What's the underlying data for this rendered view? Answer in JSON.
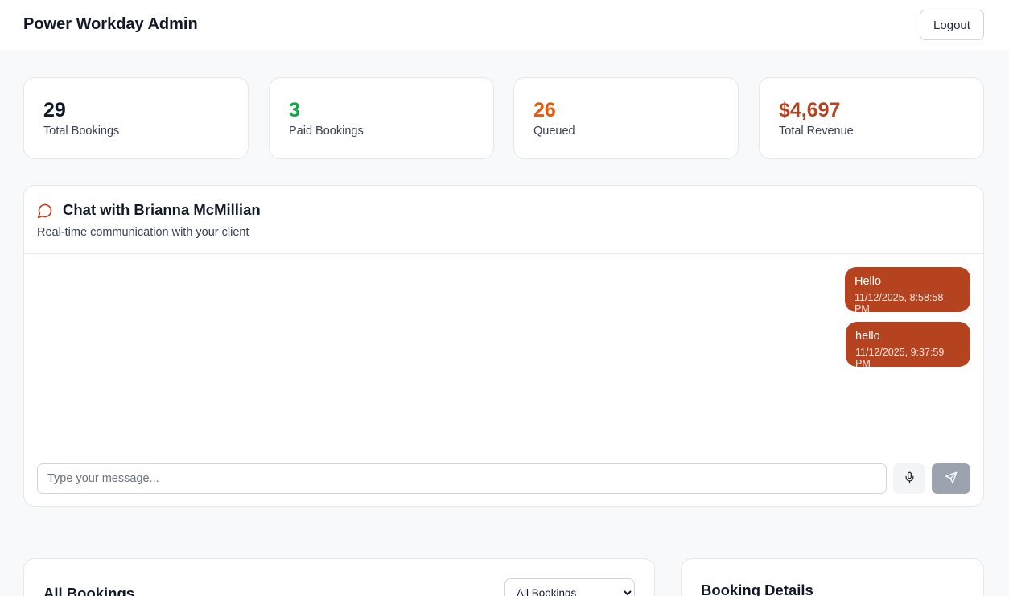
{
  "header": {
    "title": "Power Workday Admin",
    "logout_label": "Logout"
  },
  "stats": [
    {
      "value": "29",
      "label": "Total Bookings",
      "color": "#111827"
    },
    {
      "value": "3",
      "label": "Paid Bookings",
      "color": "#16a34a"
    },
    {
      "value": "26",
      "label": "Queued",
      "color": "#ea580c"
    },
    {
      "value": "$4,697",
      "label": "Total Revenue",
      "color": "#b54320"
    }
  ],
  "chat": {
    "title": "Chat with Brianna McMillian",
    "subtitle": "Real-time communication with your client",
    "messages": [
      {
        "text": "Hello",
        "time": "11/12/2025, 8:58:58 PM"
      },
      {
        "text": "hello",
        "time": "11/12/2025, 9:37:59 PM"
      }
    ],
    "input_placeholder": "Type your message...",
    "accent_color": "#b54320"
  },
  "bookings": {
    "title": "All Bookings",
    "filter_selected": "All Bookings"
  },
  "details": {
    "title": "Booking Details"
  }
}
